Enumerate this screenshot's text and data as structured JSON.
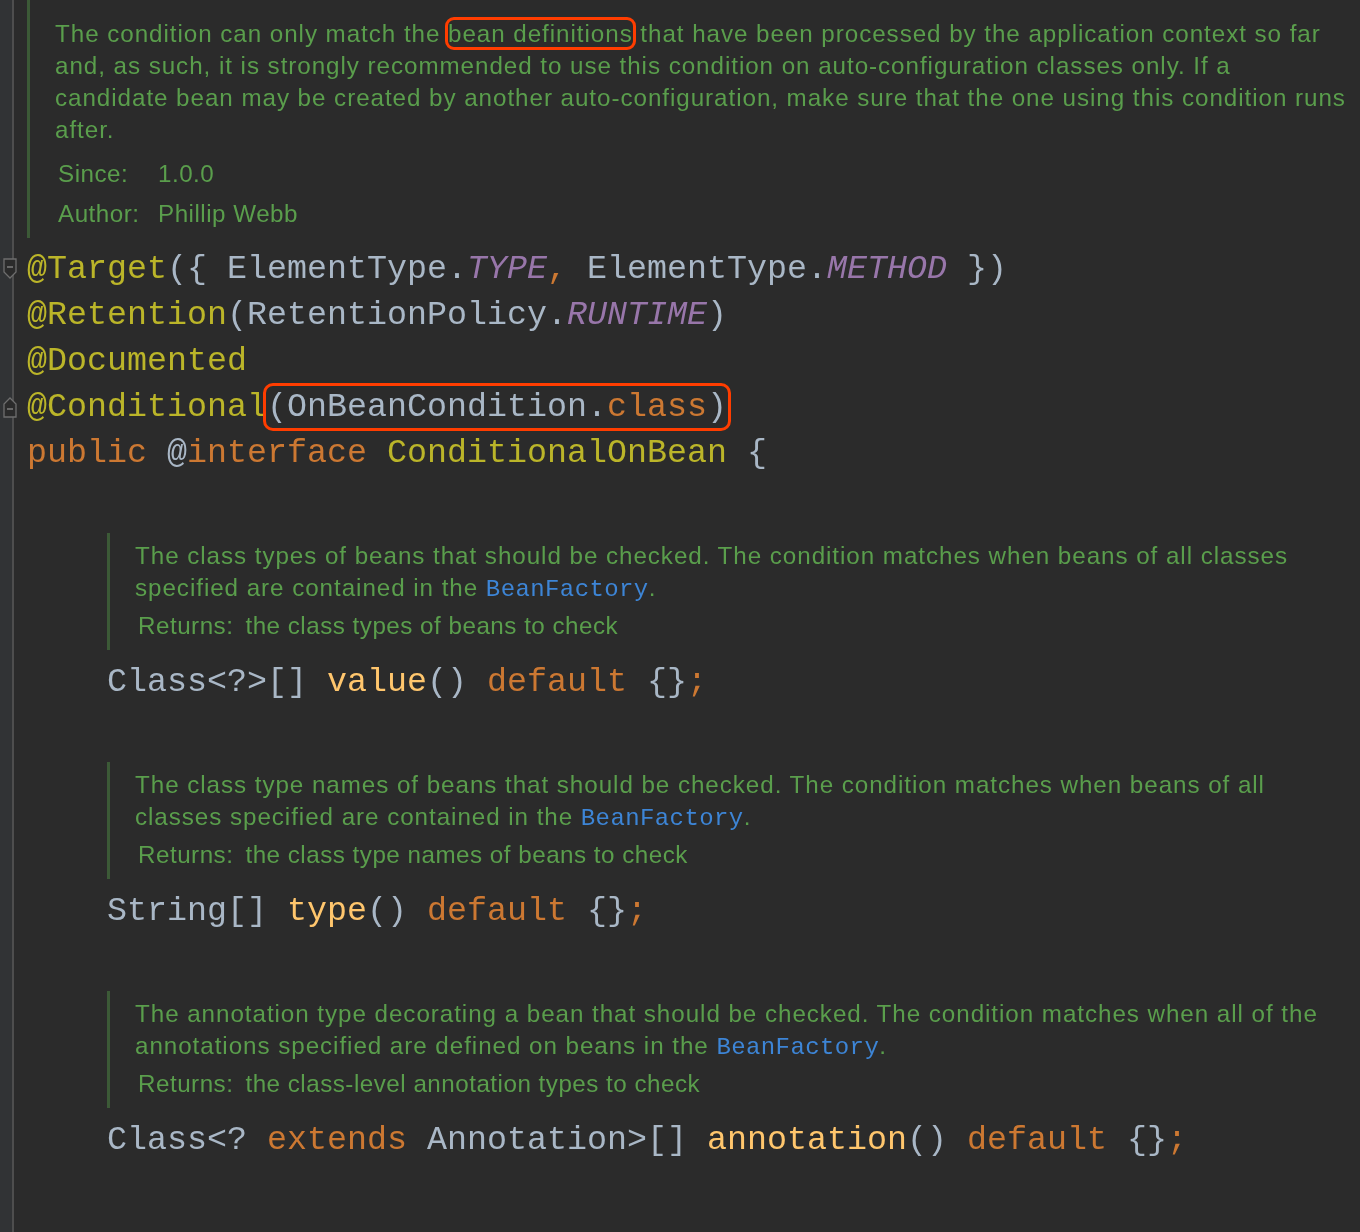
{
  "editor": {
    "class_doc": {
      "paragraph": [
        {
          "kind": "text",
          "text": "The condition can only match the "
        },
        {
          "kind": "highlight",
          "text": "bean definitions"
        },
        {
          "kind": "text",
          "text": " that have been processed by the application context so far and, as such, it is strongly recommended to use this condition on auto-configuration classes only. If a candidate bean may be created by another auto-configuration, make sure that the one using this condition runs after."
        }
      ],
      "tags": [
        {
          "label": "Since:",
          "value": "1.0.0"
        },
        {
          "label": "Author:",
          "value": "Phillip Webb"
        }
      ]
    },
    "declaration": [
      {
        "fold_start": true,
        "fold_end": false,
        "parts": [
          {
            "kind": "code",
            "tokens": [
              {
                "kind": "annotation",
                "text": "@Target"
              },
              {
                "kind": "plain",
                "text": "({ ElementType."
              },
              {
                "kind": "constant",
                "text": "TYPE"
              },
              {
                "kind": "keyword",
                "text": ","
              },
              {
                "kind": "plain",
                "text": " ElementType."
              },
              {
                "kind": "constant",
                "text": "METHOD"
              },
              {
                "kind": "plain",
                "text": " })"
              }
            ]
          }
        ]
      },
      {
        "fold_start": false,
        "fold_end": false,
        "parts": [
          {
            "kind": "code",
            "tokens": [
              {
                "kind": "annotation",
                "text": "@Retention"
              },
              {
                "kind": "plain",
                "text": "(RetentionPolicy."
              },
              {
                "kind": "constant",
                "text": "RUNTIME"
              },
              {
                "kind": "plain",
                "text": ")"
              }
            ]
          }
        ]
      },
      {
        "fold_start": false,
        "fold_end": false,
        "parts": [
          {
            "kind": "code",
            "tokens": [
              {
                "kind": "annotation",
                "text": "@Documented"
              }
            ]
          }
        ]
      },
      {
        "fold_start": false,
        "fold_end": true,
        "parts": [
          {
            "kind": "code",
            "tokens": [
              {
                "kind": "annotation",
                "text": "@Conditional"
              }
            ]
          },
          {
            "kind": "highlight",
            "tokens": [
              {
                "kind": "plain",
                "text": "(OnBeanCondition."
              },
              {
                "kind": "keyword",
                "text": "class"
              },
              {
                "kind": "plain",
                "text": ")"
              }
            ]
          }
        ]
      },
      {
        "fold_start": false,
        "fold_end": false,
        "parts": [
          {
            "kind": "code",
            "tokens": [
              {
                "kind": "keyword",
                "text": "public"
              },
              {
                "kind": "plain",
                "text": " @"
              },
              {
                "kind": "keyword",
                "text": "interface"
              },
              {
                "kind": "annotation",
                "text": " ConditionalOnBean"
              },
              {
                "kind": "plain",
                "text": " {"
              }
            ]
          }
        ]
      }
    ],
    "members": [
      {
        "doc": {
          "paragraph": [
            {
              "kind": "text",
              "text": "The class types of beans that should be checked. The condition matches when beans of all classes specified are contained in the "
            },
            {
              "kind": "link",
              "text": "BeanFactory"
            },
            {
              "kind": "text",
              "text": "."
            }
          ],
          "tags": [
            {
              "label": "Returns:",
              "value": "the class types of beans to check"
            }
          ]
        },
        "tokens": [
          {
            "kind": "plain",
            "text": "Class<?>[] "
          },
          {
            "kind": "method",
            "text": "value"
          },
          {
            "kind": "plain",
            "text": "() "
          },
          {
            "kind": "keyword",
            "text": "default"
          },
          {
            "kind": "plain",
            "text": " {}"
          },
          {
            "kind": "keyword",
            "text": ";"
          }
        ]
      },
      {
        "doc": {
          "paragraph": [
            {
              "kind": "text",
              "text": "The class type names of beans that should be checked. The condition matches when beans of all classes specified are contained in the "
            },
            {
              "kind": "link",
              "text": "BeanFactory"
            },
            {
              "kind": "text",
              "text": "."
            }
          ],
          "tags": [
            {
              "label": "Returns:",
              "value": "the class type names of beans to check"
            }
          ]
        },
        "tokens": [
          {
            "kind": "plain",
            "text": "String[] "
          },
          {
            "kind": "method",
            "text": "type"
          },
          {
            "kind": "plain",
            "text": "() "
          },
          {
            "kind": "keyword",
            "text": "default"
          },
          {
            "kind": "plain",
            "text": " {}"
          },
          {
            "kind": "keyword",
            "text": ";"
          }
        ]
      },
      {
        "doc": {
          "paragraph": [
            {
              "kind": "text",
              "text": "The annotation type decorating a bean that should be checked. The condition matches when all of the annotations specified are defined on beans in the "
            },
            {
              "kind": "link",
              "text": "BeanFactory"
            },
            {
              "kind": "text",
              "text": "."
            }
          ],
          "tags": [
            {
              "label": "Returns:",
              "value": "the class-level annotation types to check"
            }
          ]
        },
        "tokens": [
          {
            "kind": "plain",
            "text": "Class<? "
          },
          {
            "kind": "keyword",
            "text": "extends"
          },
          {
            "kind": "plain",
            "text": " Annotation>[] "
          },
          {
            "kind": "method",
            "text": "annotation"
          },
          {
            "kind": "plain",
            "text": "() "
          },
          {
            "kind": "keyword",
            "text": "default"
          },
          {
            "kind": "plain",
            "text": " {}"
          },
          {
            "kind": "keyword",
            "text": ";"
          }
        ]
      }
    ]
  }
}
